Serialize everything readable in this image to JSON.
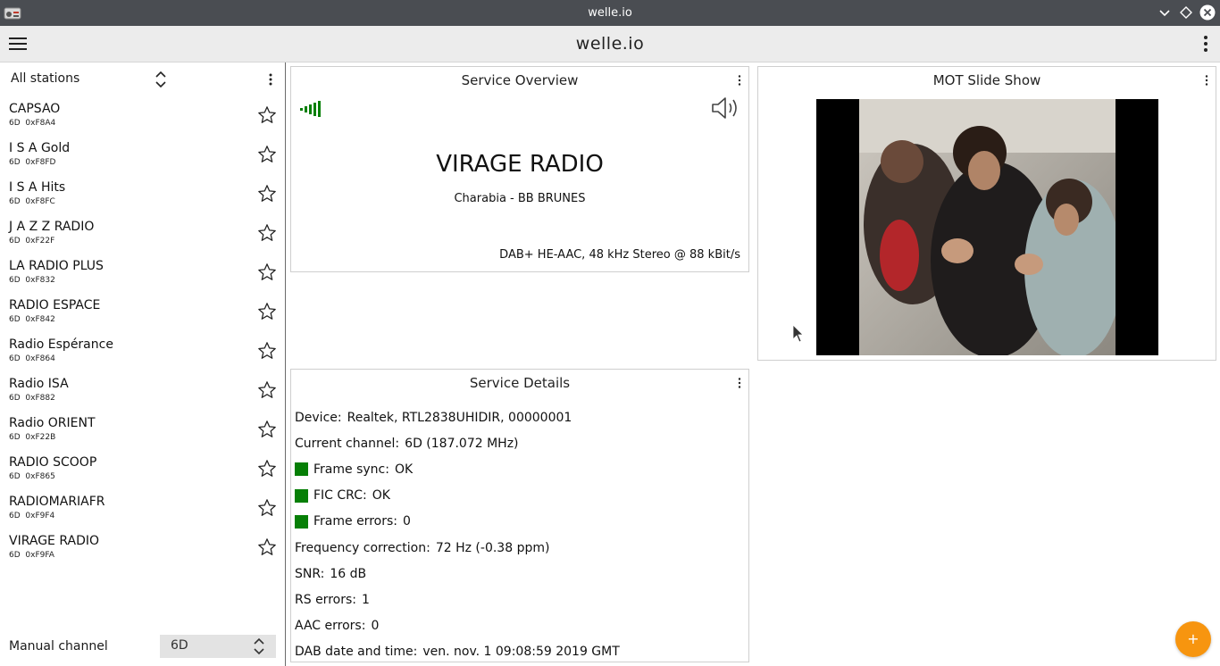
{
  "window": {
    "title": "welle.io",
    "icons": [
      "radio-app-icon",
      "minimize-icon",
      "maximize-icon",
      "close-icon"
    ]
  },
  "header": {
    "title": "welle.io",
    "icons": [
      "hamburger-menu-icon",
      "kebab-menu-icon"
    ]
  },
  "sidebar": {
    "filter_label": "All stations",
    "stations": [
      {
        "name": "CAPSAO",
        "channel": "6D",
        "id": "0xF8A4"
      },
      {
        "name": "I S A Gold",
        "channel": "6D",
        "id": "0xF8FD"
      },
      {
        "name": "I S A Hits",
        "channel": "6D",
        "id": "0xF8FC"
      },
      {
        "name": "J A Z Z RADIO",
        "channel": "6D",
        "id": "0xF22F"
      },
      {
        "name": "LA RADIO PLUS",
        "channel": "6D",
        "id": "0xF832"
      },
      {
        "name": "RADIO ESPACE",
        "channel": "6D",
        "id": "0xF842"
      },
      {
        "name": "Radio Espérance",
        "channel": "6D",
        "id": "0xF864"
      },
      {
        "name": "Radio ISA",
        "channel": "6D",
        "id": "0xF882"
      },
      {
        "name": "Radio ORIENT",
        "channel": "6D",
        "id": "0xF22B"
      },
      {
        "name": "RADIO SCOOP",
        "channel": "6D",
        "id": "0xF865"
      },
      {
        "name": "RADIOMARIAFR",
        "channel": "6D",
        "id": "0xF9F4"
      },
      {
        "name": "VIRAGE RADIO",
        "channel": "6D",
        "id": "0xF9FA"
      }
    ],
    "manual_channel_label": "Manual channel",
    "manual_channel_value": "6D"
  },
  "overview": {
    "title": "Service Overview",
    "station_name": "VIRAGE RADIO",
    "now_playing": "Charabia - BB BRUNES",
    "codec": "DAB+ HE-AAC, 48 kHz Stereo @ 88 kBit/s",
    "signal_bars": 5,
    "accent_color": "#067f06"
  },
  "slideshow": {
    "title": "MOT Slide Show"
  },
  "details": {
    "title": "Service Details",
    "device_label": "Device:",
    "device": "Realtek, RTL2838UHIDIR, 00000001",
    "channel_label": "Current channel:",
    "channel": "6D (187.072 MHz)",
    "frame_sync_label": "Frame sync:",
    "frame_sync": "OK",
    "fic_crc_label": "FIC CRC:",
    "fic_crc": "OK",
    "frame_errors_label": "Frame errors:",
    "frame_errors": "0",
    "freq_corr_label": "Frequency correction:",
    "freq_corr": "72 Hz (-0.38 ppm)",
    "snr_label": "SNR:",
    "snr": "16 dB",
    "rs_label": "RS errors:",
    "rs": "1",
    "aac_label": "AAC errors:",
    "aac": "0",
    "datetime_label": "DAB date and time:",
    "datetime": "ven. nov. 1 09:08:59 2019 GMT",
    "status_color": "#067f06"
  },
  "fab": {
    "label": "+",
    "color": "#f7950f"
  }
}
